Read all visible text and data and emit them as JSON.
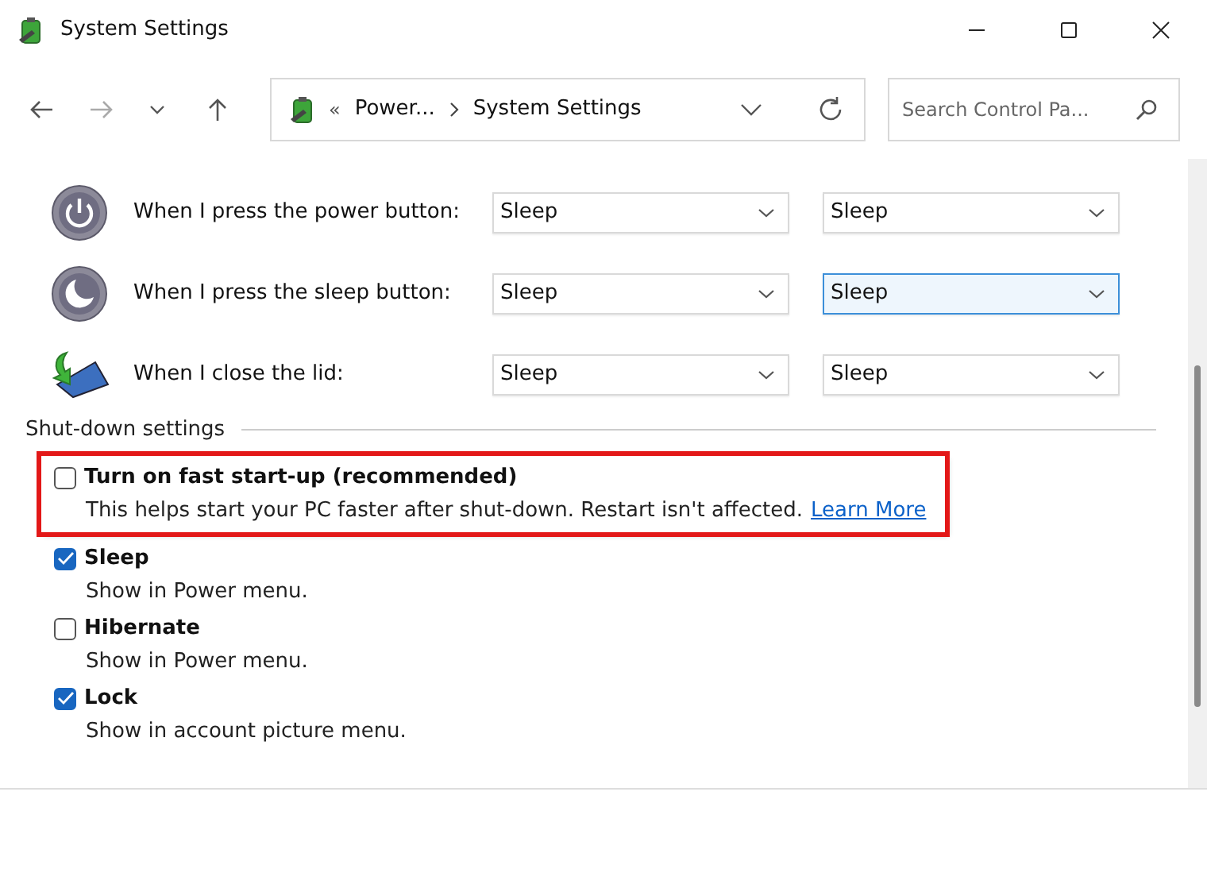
{
  "window": {
    "title": "System Settings"
  },
  "address_bar": {
    "overflow": "«",
    "crumbs": [
      "Power...",
      "System Settings"
    ]
  },
  "search": {
    "placeholder": "Search Control Pa..."
  },
  "button_rows": [
    {
      "kind": "power",
      "label": "When I press the power button:",
      "selects": [
        {
          "value": "Sleep",
          "focused": false
        },
        {
          "value": "Sleep",
          "focused": false
        }
      ]
    },
    {
      "kind": "sleep",
      "label": "When I press the sleep button:",
      "selects": [
        {
          "value": "Sleep",
          "focused": false
        },
        {
          "value": "Sleep",
          "focused": true
        }
      ]
    },
    {
      "kind": "lid",
      "label": "When I close the lid:",
      "selects": [
        {
          "value": "Sleep",
          "focused": false
        },
        {
          "value": "Sleep",
          "focused": false
        }
      ]
    }
  ],
  "shutdown": {
    "heading": "Shut-down settings",
    "items": [
      {
        "label": "Turn on fast start-up (recommended)",
        "description": "This helps start your PC faster after shut-down. Restart isn't affected.",
        "link": "Learn More",
        "checked": false,
        "highlighted": true
      },
      {
        "label": "Sleep",
        "description": "Show in Power menu.",
        "checked": true,
        "highlighted": false
      },
      {
        "label": "Hibernate",
        "description": "Show in Power menu.",
        "checked": false,
        "highlighted": false
      },
      {
        "label": "Lock",
        "description": "Show in account picture menu.",
        "checked": true,
        "highlighted": false
      }
    ]
  }
}
